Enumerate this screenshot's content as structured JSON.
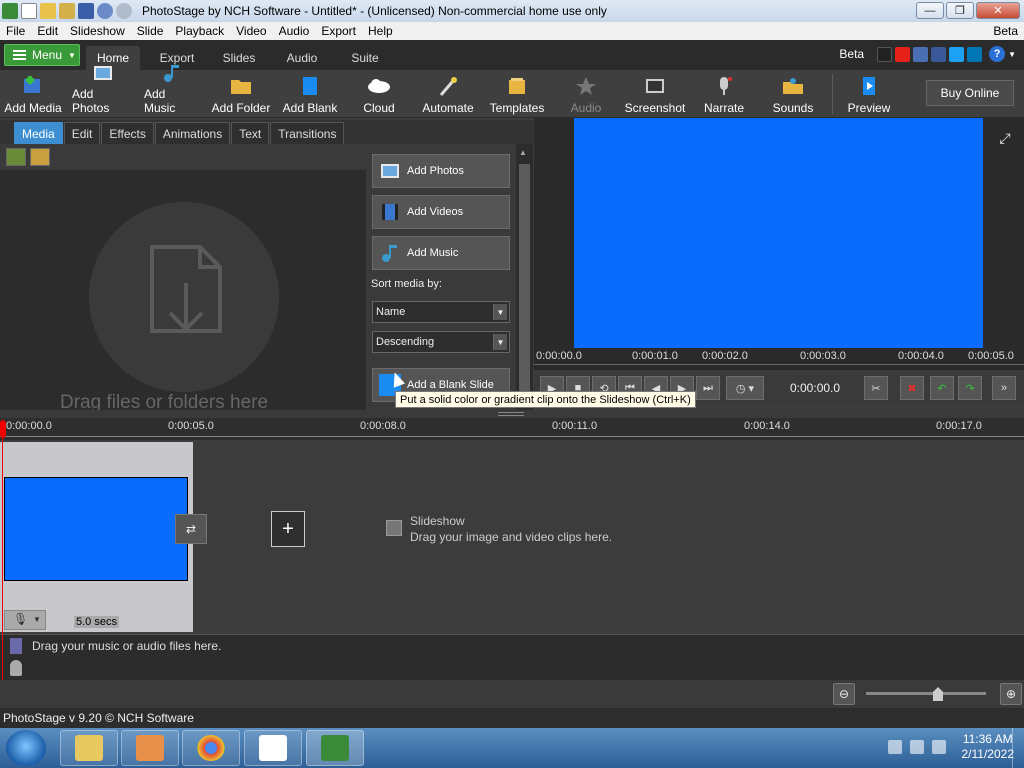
{
  "window": {
    "title": "PhotoStage by NCH Software - Untitled* - (Unlicensed) Non-commercial home use only",
    "controls": {
      "minimize": "—",
      "maximize": "❐",
      "close": "✕"
    }
  },
  "menubar": {
    "items": [
      "File",
      "Edit",
      "Slideshow",
      "Slide",
      "Playback",
      "Video",
      "Audio",
      "Export",
      "Help"
    ],
    "beta": "Beta"
  },
  "ribbon": {
    "menu_label": "Menu",
    "tabs": [
      "Home",
      "Export",
      "Slides",
      "Audio",
      "Suite"
    ],
    "active_tab": "Home",
    "beta": "Beta",
    "help": "?"
  },
  "toolbar": {
    "items": [
      {
        "label": "Add Media",
        "icon": "add-media-icon"
      },
      {
        "label": "Add Photos",
        "icon": "add-photos-icon"
      },
      {
        "label": "Add Music",
        "icon": "add-music-icon"
      },
      {
        "label": "Add Folder",
        "icon": "add-folder-icon"
      },
      {
        "label": "Add Blank",
        "icon": "add-blank-icon"
      },
      {
        "label": "Cloud",
        "icon": "cloud-icon"
      },
      {
        "label": "Automate",
        "icon": "automate-icon"
      },
      {
        "label": "Templates",
        "icon": "templates-icon"
      },
      {
        "label": "Audio",
        "icon": "audio-icon"
      },
      {
        "label": "Screenshot",
        "icon": "screenshot-icon"
      },
      {
        "label": "Narrate",
        "icon": "microphone-icon"
      },
      {
        "label": "Sounds",
        "icon": "sounds-icon"
      },
      {
        "label": "Preview",
        "icon": "preview-icon"
      }
    ],
    "buy_online": "Buy Online"
  },
  "media_panel": {
    "tabs": [
      "Media",
      "Edit",
      "Effects",
      "Animations",
      "Text",
      "Transitions"
    ],
    "active_tab": "Media",
    "drop_text": "Drag files or folders here",
    "buttons": {
      "add_photos": "Add Photos",
      "add_videos": "Add Videos",
      "add_music": "Add Music",
      "add_blank_slide": "Add a Blank Slide"
    },
    "sort_label": "Sort media by:",
    "sort_by": "Name",
    "sort_order": "Descending"
  },
  "tooltip": "Put a solid color or gradient clip onto the Slideshow (Ctrl+K)",
  "preview": {
    "screen_color": "#0A6CFF",
    "ruler_ticks": [
      "0:00:00.0",
      "0:00:01.0",
      "0:00:02.0",
      "0:00:03.0",
      "0:00:04.0",
      "0:00:05.0"
    ],
    "timecode": "0:00:00.0"
  },
  "timeline": {
    "ruler_ticks": [
      "0:00:00.0",
      "0:00:05.0",
      "0:00:08.0",
      "0:00:11.0",
      "0:00:14.0",
      "0:00:17.0"
    ],
    "clip_duration": "5.0 secs",
    "slideshow_title": "Slideshow",
    "slideshow_hint": "Drag your image and video clips here.",
    "audio_hint": "Drag your music or audio files here."
  },
  "statusbar": {
    "text": "PhotoStage v 9.20 © NCH Software"
  },
  "taskbar": {
    "time": "11:36 AM",
    "date": "2/11/2022"
  }
}
